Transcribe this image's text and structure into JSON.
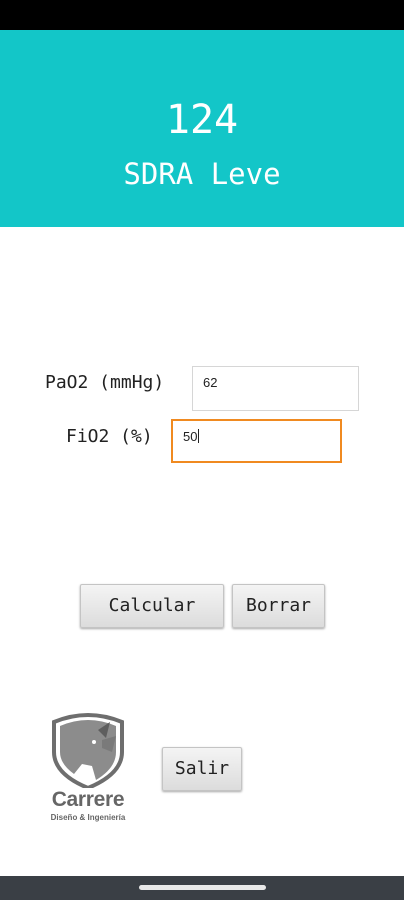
{
  "result": {
    "value": "124",
    "classification": "SDRA Leve"
  },
  "form": {
    "pao2": {
      "label": "PaO2 (mmHg)",
      "value": "62"
    },
    "fio2": {
      "label": "FiO2 (%)",
      "value": "50"
    }
  },
  "buttons": {
    "calcular": "Calcular",
    "borrar": "Borrar",
    "salir": "Salir"
  },
  "logo": {
    "name": "Carrere",
    "tagline": "Diseño & Ingeniería"
  },
  "colors": {
    "header": "#13c6c8",
    "focus_border": "#f08a20",
    "nav_bar": "#3a3f45"
  }
}
